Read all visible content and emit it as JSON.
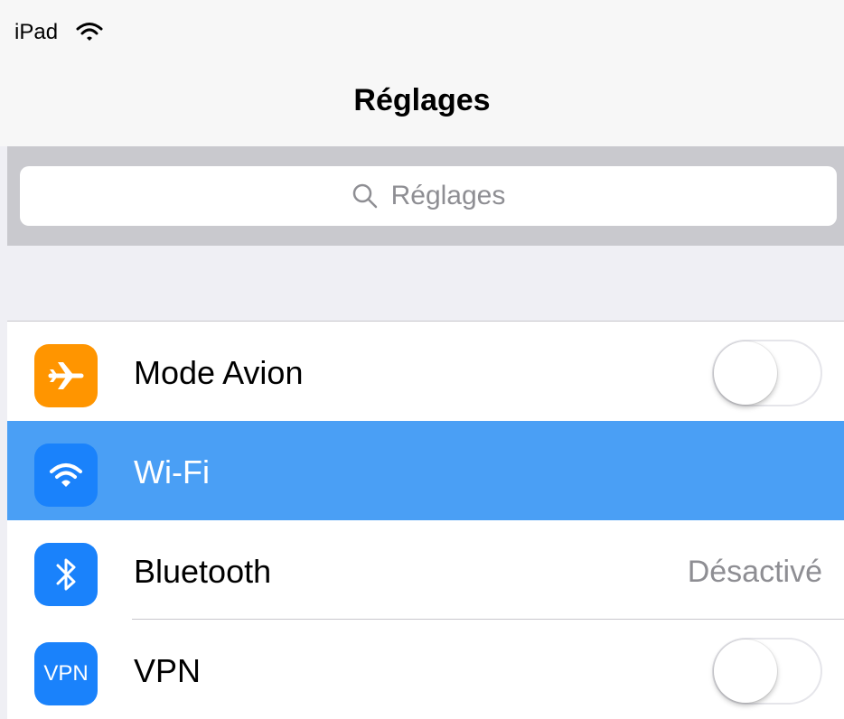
{
  "status_bar": {
    "device": "iPad",
    "wifi_icon": "wifi-icon"
  },
  "nav": {
    "title": "Réglages"
  },
  "search": {
    "placeholder": "Réglages",
    "icon": "search-icon"
  },
  "settings": {
    "airplane": {
      "label": "Mode Avion",
      "icon": "airplane-icon",
      "icon_color": "#ff9500",
      "toggle_on": false
    },
    "wifi": {
      "label": "Wi-Fi",
      "icon": "wifi-icon",
      "icon_color": "#1a82fb",
      "selected": true
    },
    "bluetooth": {
      "label": "Bluetooth",
      "value": "Désactivé",
      "icon": "bluetooth-icon",
      "icon_color": "#1a82fb"
    },
    "vpn": {
      "label": "VPN",
      "icon_text": "VPN",
      "icon_color": "#1a82fb",
      "toggle_on": false
    }
  },
  "colors": {
    "selection": "#4a9ff5",
    "background": "#efeff4"
  }
}
